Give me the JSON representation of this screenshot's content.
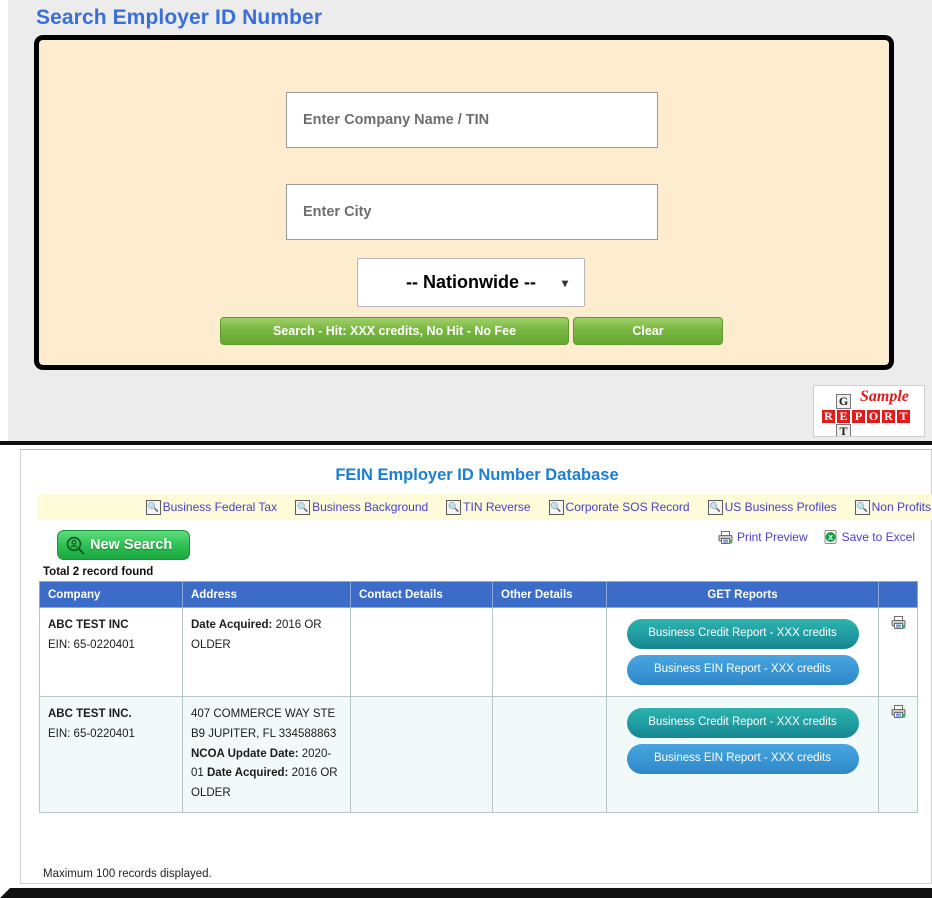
{
  "search_panel": {
    "title": "Search Employer ID Number",
    "company_field": {
      "placeholder": "Enter Company Name / TIN",
      "value": ""
    },
    "city_field": {
      "placeholder": "Enter City",
      "value": ""
    },
    "state_select": {
      "value": "-- Nationwide --",
      "chevron": "chevron-down-icon"
    },
    "search_button": "Search - Hit: XXX credits, No Hit - No Fee",
    "clear_button": "Clear",
    "stamp": {
      "sample_text": "Sample",
      "across_word": [
        "R",
        "E",
        "P",
        "O",
        "R",
        "T"
      ],
      "down_word": [
        "G",
        "E",
        "T"
      ]
    }
  },
  "results_panel": {
    "title": "FEIN Employer ID Number Database",
    "nav_links": [
      {
        "label": "Business Federal Tax",
        "icon": "search-icon"
      },
      {
        "label": "Business Background",
        "icon": "search-icon"
      },
      {
        "label": "TIN Reverse",
        "icon": "search-icon"
      },
      {
        "label": "Corporate SOS Record",
        "icon": "search-icon"
      },
      {
        "label": "US Business Profiles",
        "icon": "search-icon"
      },
      {
        "label": "Non Profits",
        "icon": "search-icon"
      }
    ],
    "new_search_button": "New Search",
    "total_found": "Total 2 record found",
    "print_preview": "Print Preview",
    "save_to_excel": "Save to Excel",
    "columns": [
      "Company",
      "Address",
      "Contact Details",
      "Other Details",
      "GET Reports",
      ""
    ],
    "rows": [
      {
        "company_name": "ABC TEST INC",
        "company_ein": "EIN: 65-0220401",
        "address_lines": [
          {
            "label": "Date Acquired:",
            "value": " 2016 OR OLDER"
          }
        ],
        "contact_details": "",
        "other_details": "",
        "credit_report_button": "Business Credit Report - XXX credits",
        "ein_report_button": "Business EIN Report - XXX credits",
        "print_icon": "printer-icon"
      },
      {
        "company_name": "ABC TEST INC.",
        "company_ein": "EIN: 65-0220401",
        "address_lines": [
          {
            "label": "",
            "value": "407 COMMERCE WAY STE B9 JUPITER, FL 334588863"
          },
          {
            "label": "NCOA Update Date:",
            "value": " 2020-01"
          },
          {
            "label": "Date Acquired:",
            "value": " 2016 OR OLDER"
          }
        ],
        "contact_details": "",
        "other_details": "",
        "credit_report_button": "Business Credit Report - XXX credits",
        "ein_report_button": "Business EIN Report - XXX credits",
        "print_icon": "printer-icon"
      }
    ],
    "footer_note": "Maximum 100 records displayed."
  }
}
